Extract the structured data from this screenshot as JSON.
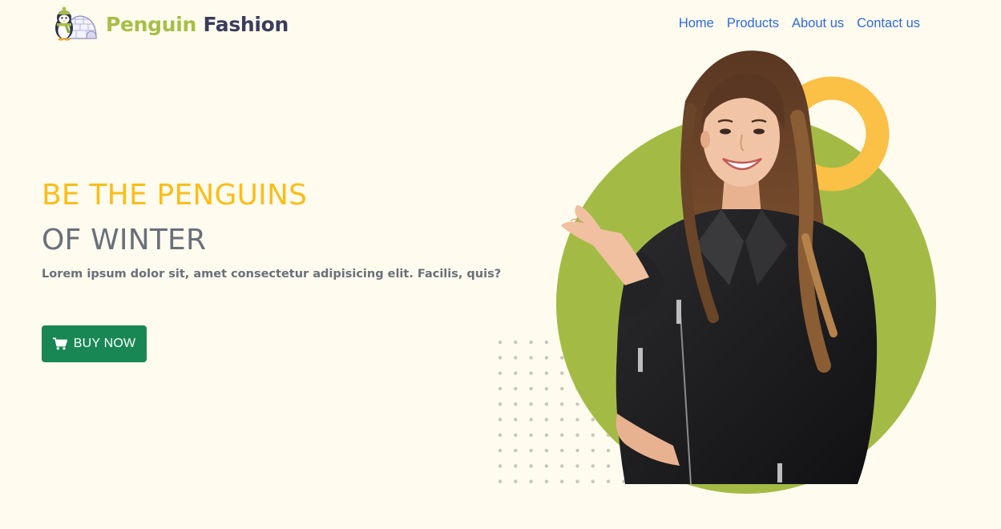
{
  "brand": {
    "word1": "Penguin",
    "word2": "Fashion",
    "logo_icon": "penguin-igloo-logo"
  },
  "nav": {
    "links": [
      {
        "label": "Home"
      },
      {
        "label": "Products"
      },
      {
        "label": "About us"
      },
      {
        "label": "Contact us"
      }
    ]
  },
  "hero": {
    "title_line_1": "BE THE PENGUINS",
    "title_line_2": "OF WINTER",
    "subtitle": "Lorem ipsum dolor sit, amet consectetur adipisicing elit. Facilis, quis?",
    "cta_label": "BUY NOW",
    "cta_icon": "cart-icon",
    "image_subject": "model-photo"
  },
  "colors": {
    "background": "#fffbef",
    "brand_green": "#a6bf46",
    "brand_navy": "#3b3d5c",
    "accent_yellow": "#fbbd1a",
    "ring_orange": "#fbc046",
    "circle_green": "#a3bb45",
    "nav_link": "#2d6bd8",
    "button_green": "#198754",
    "heading_gray": "#687079"
  }
}
